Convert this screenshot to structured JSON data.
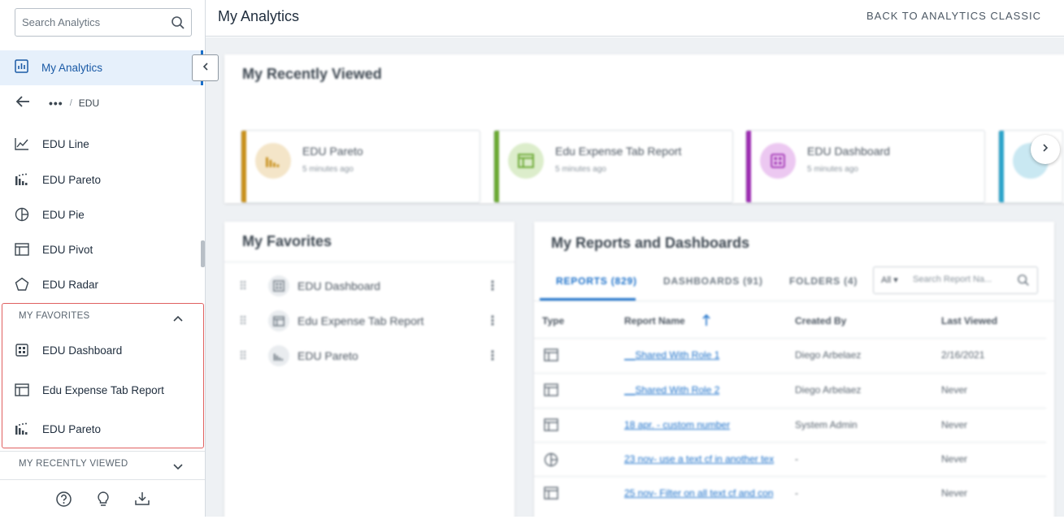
{
  "search": {
    "placeholder": "Search Analytics"
  },
  "sidebar": {
    "active_label": "My Analytics",
    "breadcrumb": {
      "dots": "•••",
      "sep": "/",
      "current": "EDU"
    },
    "items": [
      {
        "label": "EDU Line",
        "icon": "line-chart-icon"
      },
      {
        "label": "EDU Pareto",
        "icon": "pareto-chart-icon"
      },
      {
        "label": "EDU Pie",
        "icon": "pie-chart-icon"
      },
      {
        "label": "EDU Pivot",
        "icon": "pivot-table-icon"
      },
      {
        "label": "EDU Radar",
        "icon": "radar-chart-icon"
      }
    ],
    "favorites_title": "MY FAVORITES",
    "favorites": [
      {
        "label": "EDU Dashboard",
        "icon": "dashboard-icon"
      },
      {
        "label": "Edu Expense Tab Report",
        "icon": "table-report-icon"
      },
      {
        "label": "EDU Pareto",
        "icon": "pareto-chart-icon"
      }
    ],
    "recent_title": "MY RECENTLY VIEWED"
  },
  "header": {
    "title": "My Analytics",
    "back_link": "BACK TO ANALYTICS CLASSIC"
  },
  "recently_viewed": {
    "title": "My Recently Viewed",
    "items": [
      {
        "name": "EDU Pareto",
        "time": "5 minutes ago",
        "color": "#c8901c"
      },
      {
        "name": "Edu Expense Tab Report",
        "time": "5 minutes ago",
        "color": "#6aa832"
      },
      {
        "name": "EDU Dashboard",
        "time": "5 minutes ago",
        "color": "#9c2bb0"
      }
    ]
  },
  "favorites_panel": {
    "title": "My Favorites",
    "items": [
      {
        "name": "EDU Dashboard"
      },
      {
        "name": "Edu Expense Tab Report"
      },
      {
        "name": "EDU Pareto"
      }
    ]
  },
  "reports_panel": {
    "title": "My Reports and Dashboards",
    "tabs": [
      {
        "label": "REPORTS (829)"
      },
      {
        "label": "DASHBOARDS (91)"
      },
      {
        "label": "FOLDERS (4)"
      }
    ],
    "filter": "All",
    "search_placeholder": "Search Report Na...",
    "columns": [
      "Type",
      "Report Name",
      "Created By",
      "Last Viewed"
    ],
    "rows": [
      {
        "type": "table",
        "name": "__Shared With Role 1",
        "created_by": "Diego Arbelaez",
        "last_viewed": "2/16/2021"
      },
      {
        "type": "table",
        "name": "__Shared With Role 2",
        "created_by": "Diego Arbelaez",
        "last_viewed": "Never"
      },
      {
        "type": "table",
        "name": "18 apr. - custom number",
        "created_by": "System Admin",
        "last_viewed": "Never"
      },
      {
        "type": "pie",
        "name": "23 nov- use a text cf in another tex",
        "created_by": "-",
        "last_viewed": "Never"
      },
      {
        "type": "table",
        "name": "25 nov- Filter on all text cf and con",
        "created_by": "-",
        "last_viewed": "Never"
      }
    ]
  },
  "colors": {
    "accent": "#1a6fc9",
    "active_bg": "#e6f0fb",
    "favorites_border": "#e06060"
  }
}
